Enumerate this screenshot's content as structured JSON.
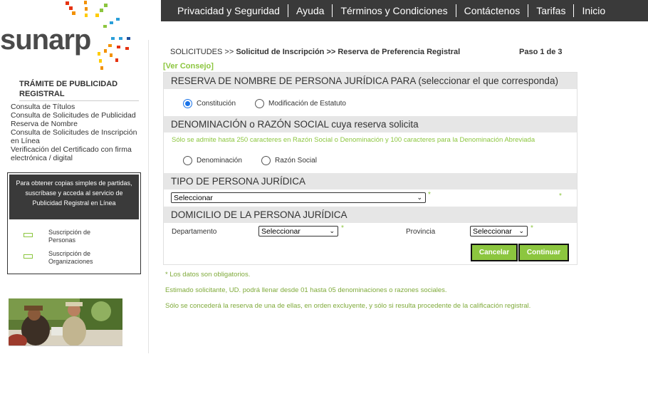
{
  "nav": {
    "items": [
      "Privacidad y Seguridad",
      "Ayuda",
      "Términos y Condiciones",
      "Contáctenos",
      "Tarifas",
      "Inicio"
    ]
  },
  "logo": {
    "text": "sunarp"
  },
  "sidebar": {
    "title": "TRÁMITE DE PUBLICIDAD REGISTRAL",
    "links": [
      "Consulta de Títulos",
      "Consulta de Solicitudes de Publicidad",
      "Reserva de Nombre",
      "Consulta de Solicitudes de Inscripción en Línea",
      "Verificación del Certificado con firma electrónica / digital"
    ],
    "promo": {
      "text": "Para obtener copias simples de partidas, suscríbase y acceda al servicio de Publicidad Registral en Línea",
      "items": [
        "Suscripción de Personas",
        "Suscripción de Organizaciones"
      ]
    }
  },
  "breadcrumb": {
    "prefix": "SOLICITUDES >>",
    "middle": "Solicitud de Inscripción >> Reserva de Preferencia Registral",
    "step": "Paso 1 de 3"
  },
  "tip_link": "[Ver Consejo]",
  "form": {
    "section1": {
      "title": "RESERVA DE NOMBRE DE PERSONA JURÍDICA PARA (seleccionar el que corresponda)",
      "options": [
        "Constitución",
        "Modificación de Estatuto"
      ],
      "selected": "Constitución"
    },
    "section2": {
      "title": "DENOMINACIÓN o RAZÓN SOCIAL cuya reserva solicita",
      "note": "Sólo se admite hasta 250 caracteres en Razón Social o Denominación y 100 caracteres para la Denominación Abreviada",
      "options": [
        "Denominación",
        "Razón Social"
      ]
    },
    "section3": {
      "title": "TIPO DE PERSONA JURÍDICA",
      "select_value": "Seleccionar",
      "required_mark": "*"
    },
    "section4": {
      "title": "DOMICILIO DE LA PERSONA JURÍDICA",
      "departamento_label": "Departamento",
      "departamento_value": "Seleccionar",
      "provincia_label": "Provincia",
      "provincia_value": "Seleccionar",
      "required_mark": "*"
    },
    "buttons": {
      "cancel": "Cancelar",
      "continue": "Continuar"
    }
  },
  "footer_notes": [
    "* Los datos son obligatorios.",
    "Estimado solicitante, UD. podrá llenar desde 01 hasta 05 denominaciones o razones sociales.",
    "Sólo se concederá la reserva de una de ellas, en orden excluyente, y sólo si resulta procedente de la calificación registral."
  ],
  "colors": {
    "accent": "#8cc63f",
    "nav_bg": "#3a3a3a",
    "section_bg": "#e6e6e6"
  }
}
